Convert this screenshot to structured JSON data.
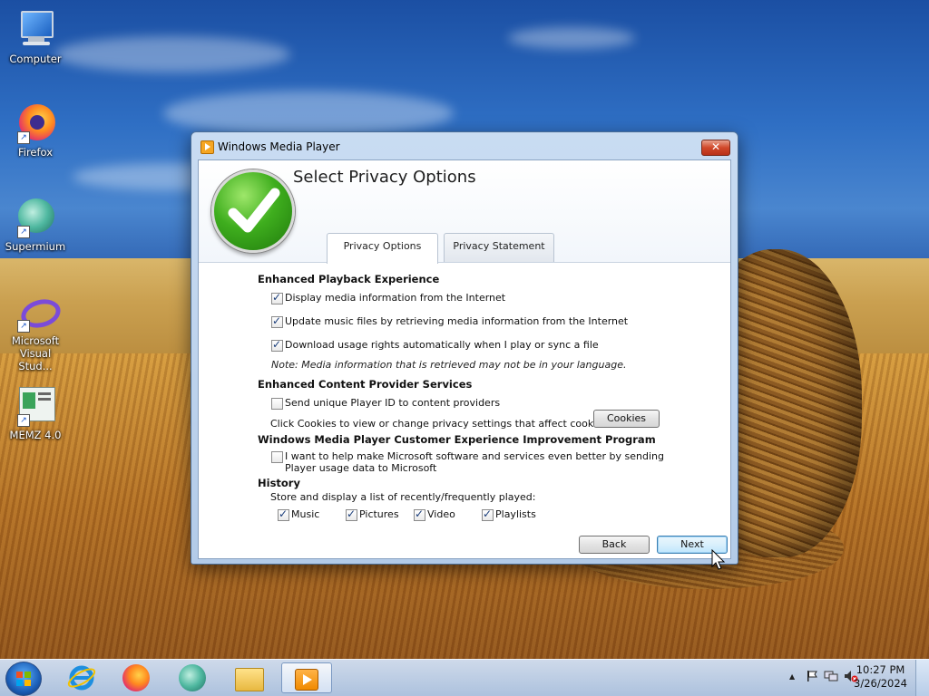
{
  "desktop": {
    "icons": [
      {
        "label": "Computer"
      },
      {
        "label": "Firefox"
      },
      {
        "label": "Supermium"
      },
      {
        "label": "Microsoft Visual Stud..."
      },
      {
        "label": "MEMZ 4.0"
      }
    ]
  },
  "dialog": {
    "title": "Windows Media Player",
    "close_label": "✕",
    "heading": "Select Privacy Options",
    "tabs": [
      {
        "label": "Privacy Options",
        "active": true
      },
      {
        "label": "Privacy Statement",
        "active": false
      }
    ],
    "playback": {
      "title": "Enhanced Playback Experience",
      "options": [
        {
          "label": "Display media information from the Internet",
          "checked": true
        },
        {
          "label": "Update music files by retrieving media information from the Internet",
          "checked": true
        },
        {
          "label": "Download usage rights automatically when I play or sync a file",
          "checked": true
        }
      ],
      "note": "Note: Media information that is retrieved may not be in your language."
    },
    "content_provider": {
      "title": "Enhanced Content Provider Services",
      "option": {
        "label": "Send unique Player ID to content providers",
        "checked": false
      },
      "cookies_text": "Click Cookies to view or change privacy settings that affect cookies",
      "cookies_button": "Cookies"
    },
    "ceip": {
      "title": "Windows Media Player Customer Experience Improvement Program",
      "option_line1": "I want to help make Microsoft software and services even better by sending",
      "option_line2": "Player usage data to Microsoft",
      "checked": false
    },
    "history": {
      "title": "History",
      "text": "Store and display a list of recently/frequently played:",
      "items": [
        {
          "label": "Music",
          "checked": true
        },
        {
          "label": "Pictures",
          "checked": true
        },
        {
          "label": "Video",
          "checked": true
        },
        {
          "label": "Playlists",
          "checked": true
        }
      ]
    },
    "back_button": "Back",
    "next_button": "Next"
  },
  "taskbar": {
    "clock_time": "10:27 PM",
    "clock_date": "3/26/2024",
    "tray_arrow": "▲",
    "active_app": "Windows Media Player"
  }
}
